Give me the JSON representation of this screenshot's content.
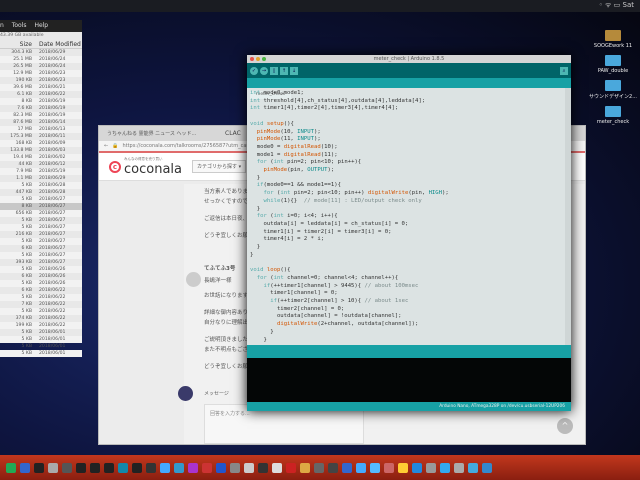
{
  "menubar": {
    "status": "◦ ᯤ ▭ Sat"
  },
  "finder": {
    "menu": [
      "n",
      "Tools",
      "Help"
    ],
    "info": "43.39 GB available",
    "columns": [
      "Size",
      "Date Modified"
    ],
    "rows": [
      [
        "304.3 KB",
        "2018/06/29"
      ],
      [
        "25.1 MB",
        "2018/06/24"
      ],
      [
        "26.5 MB",
        "2018/06/24"
      ],
      [
        "12.9 MB",
        "2018/06/23"
      ],
      [
        "190 KB",
        "2018/06/23"
      ],
      [
        "39.6 MB",
        "2018/06/21"
      ],
      [
        "6.1 KB",
        "2018/06/22"
      ],
      [
        "8 KB",
        "2018/06/19"
      ],
      [
        "7.6 KB",
        "2018/06/19"
      ],
      [
        "82.3 MB",
        "2018/06/19"
      ],
      [
        "87.6 MB",
        "2018/06/14"
      ],
      [
        "17 MB",
        "2018/06/13"
      ],
      [
        "175.3 MB",
        "2018/06/11"
      ],
      [
        "168 KB",
        "2018/06/09"
      ],
      [
        "133.8 MB",
        "2018/06/03"
      ],
      [
        "19.4 MB",
        "2018/06/02"
      ],
      [
        "44 KB",
        "2018/06/12"
      ],
      [
        "7.9 MB",
        "2018/05/19"
      ],
      [
        "1.1 MB",
        "2018/06/29"
      ],
      [
        "5 KB",
        "2018/06/28"
      ],
      [
        "447 KB",
        "2018/06/28"
      ],
      [
        "5 KB",
        "2018/06/27"
      ],
      [
        "8 KB",
        "2018/06/27"
      ],
      [
        "656 KB",
        "2018/06/27"
      ],
      [
        "5 KB",
        "2018/06/27"
      ],
      [
        "5 KB",
        "2018/06/27"
      ],
      [
        "216 KB",
        "2018/06/27"
      ],
      [
        "5 KB",
        "2018/06/27"
      ],
      [
        "6 KB",
        "2018/06/27"
      ],
      [
        "5 KB",
        "2018/06/27"
      ],
      [
        "393 KB",
        "2018/06/27"
      ],
      [
        "5 KB",
        "2018/06/26"
      ],
      [
        "6 KB",
        "2018/06/26"
      ],
      [
        "5 KB",
        "2018/06/26"
      ],
      [
        "6 KB",
        "2018/06/22"
      ],
      [
        "5 KB",
        "2018/06/22"
      ],
      [
        "7 KB",
        "2018/06/22"
      ],
      [
        "5 KB",
        "2018/06/22"
      ],
      [
        "374 KB",
        "2018/06/22"
      ],
      [
        "199 KB",
        "2018/06/22"
      ],
      [
        "5 KB",
        "2018/06/01"
      ],
      [
        "5 KB",
        "2018/06/01"
      ],
      [
        "5 KB",
        "2018/06/01"
      ],
      [
        "5 KB",
        "2018/06/01"
      ]
    ]
  },
  "desktop_icons": [
    "SOOGEwork 11",
    "PAW_double",
    "サウンドデザイン2...",
    "meter_check"
  ],
  "browser": {
    "tab": "うちゃんねる 霊能界 ニュース ヘッド...",
    "tab2": "CLAC",
    "url": "https://coconala.com/talkrooms/2756587?utm_campai...",
    "logo": "coconala",
    "logo_tagline": "みんなの得意を売り買い",
    "category_button": "カテゴリから探す ▾",
    "messages": [
      "当方素人でありますので、...",
      "せっかくですので、ご...",
      "ご返信は本日夜、もし...",
      "どうぞ宜しくお願い致..."
    ],
    "sender": "てふてふ3号",
    "greeting": "長嶋洋一様",
    "messages2": [
      "お世話になります。て...",
      "詳細な御内容ありがと...",
      "自分なりに理解出来た...",
      "ご説明頂きました仕様...",
      "また不明点もございま...",
      "どうぞ宜しくお願い致..."
    ],
    "message_label": "メッセージ",
    "reply_placeholder": "回答を入力する..."
  },
  "arduino": {
    "title": "meter_check | Arduino 1.8.5",
    "tab": "meter_check",
    "status": "Arduino Nano, ATmega328P on /dev/cu.usbserial-12UP206",
    "code": [
      "int mode0,mode1;",
      "int threshold[4],ch_status[4],outdata[4],leddata[4];",
      "int timer1[4],timer2[4],timer3[4],timer4[4];",
      "",
      "void setup(){",
      "  pinMode(10, INPUT);",
      "  pinMode(11, INPUT);",
      "  mode0 = digitalRead(10);",
      "  mode1 = digitalRead(11);",
      "  for (int pin=2; pin<10; pin++){",
      "    pinMode(pin, OUTPUT);",
      "  }",
      "  if(mode0==1 && mode1==1){",
      "    for (int pin=2; pin<10; pin++) digitalWrite(pin, HIGH);",
      "    while(1){}  // mode[11] : LED/output check only",
      "  }",
      "  for (int i=0; i<4; i++){",
      "    outdata[i] = leddata[i] = ch_status[i] = 0;",
      "    timer1[i] = timer2[i] = timer3[i] = 0;",
      "    timer4[i] = 2 * i;",
      "  }",
      "}",
      "",
      "void loop(){",
      "  for (int channel=0; channel<4; channel++){",
      "    if(++timer1[channel] > 9445){ // about 100msec",
      "      timer1[channel] = 0;",
      "      if(++timer2[channel] > 10){ // about 1sec",
      "        timer2[channel] = 0;",
      "        outdata[channel] = !outdata[channel];",
      "        digitalWrite(2+channel, outdata[channel]);",
      "      }",
      "    }"
    ]
  }
}
